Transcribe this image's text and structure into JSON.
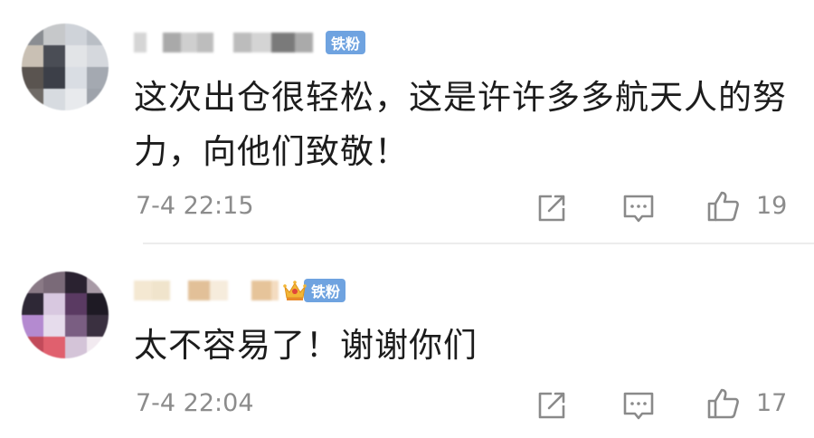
{
  "comments": [
    {
      "badge": "铁粉",
      "text": "这次出仓很轻松，这是许许多多航天人的努力，向他们致敬！",
      "time": "7-4 22:15",
      "likes": "19",
      "has_crown": false
    },
    {
      "badge": "铁粉",
      "text": "太不容易了！谢谢你们",
      "time": "7-4 22:04",
      "likes": "17",
      "has_crown": true
    }
  ],
  "icons": {
    "share": "share-icon",
    "reply": "comment-icon",
    "like": "thumbs-up-icon",
    "crown": "crown-icon"
  },
  "colors": {
    "badge_bg": "#6fa3e0",
    "text": "#1c1c1c",
    "meta": "#8c8c8c",
    "icon": "#8a8a8a"
  }
}
